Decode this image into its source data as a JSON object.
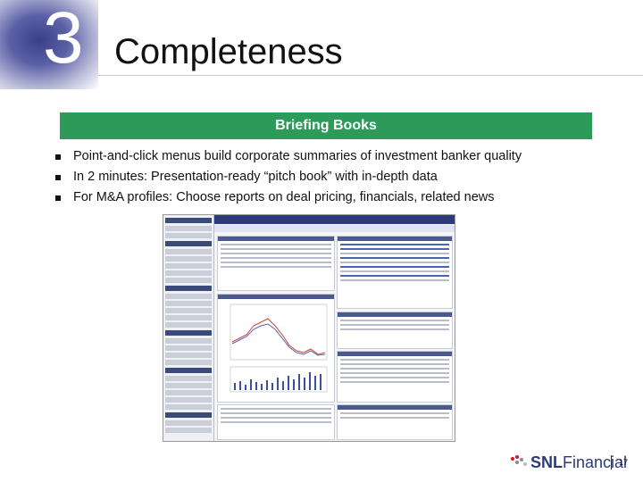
{
  "slide": {
    "number": "3",
    "title": "Completeness",
    "banner": "Briefing Books",
    "bullets": [
      "Point-and-click menus build corporate summaries of investment banker quality",
      "In 2 minutes: Presentation-ready “pitch book” with in-depth data",
      "For M&A profiles: Choose reports on deal pricing, financials, related news"
    ],
    "logo_bold": "SNL",
    "logo_rest": "Financial",
    "page_number": "17",
    "colors": {
      "banner": "#2e9a5a",
      "brand": "#2b3a78"
    }
  }
}
